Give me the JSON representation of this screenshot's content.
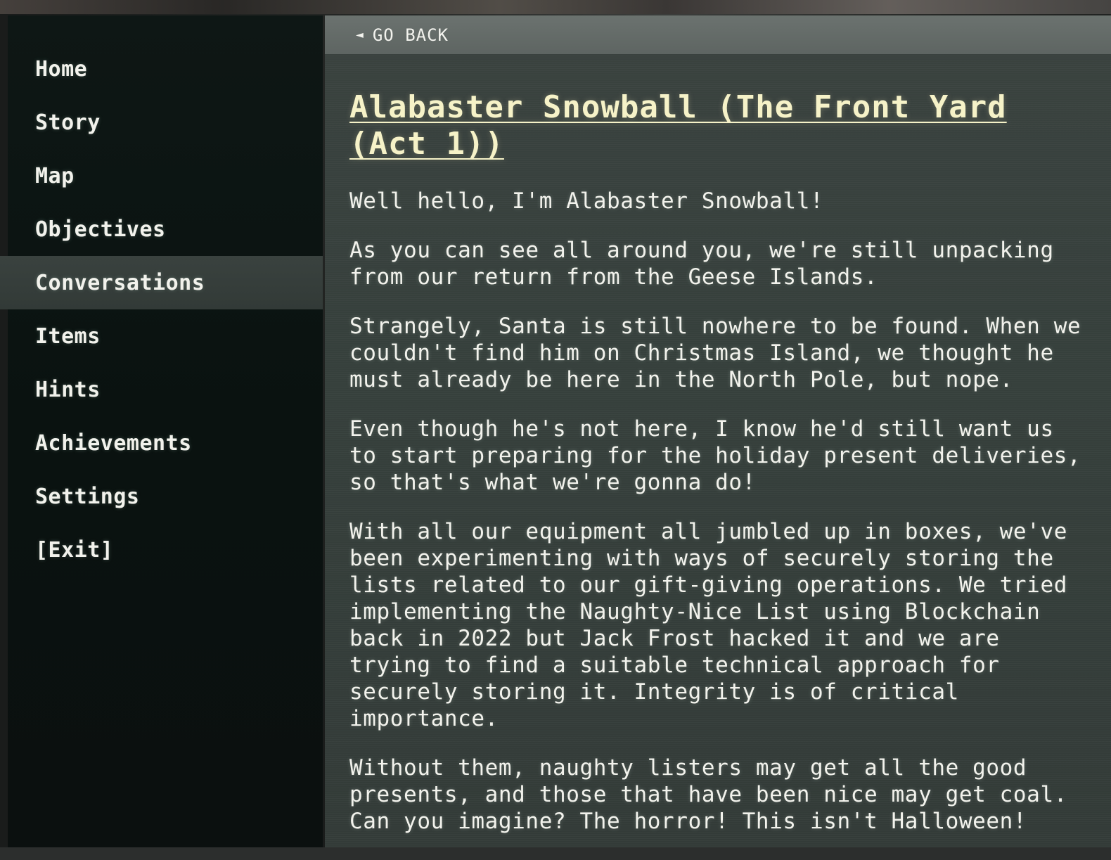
{
  "sidebar": {
    "items": [
      {
        "label": "Home",
        "active": false
      },
      {
        "label": "Story",
        "active": false
      },
      {
        "label": "Map",
        "active": false
      },
      {
        "label": "Objectives",
        "active": false
      },
      {
        "label": "Conversations",
        "active": true
      },
      {
        "label": "Items",
        "active": false
      },
      {
        "label": "Hints",
        "active": false
      },
      {
        "label": "Achievements",
        "active": false
      },
      {
        "label": "Settings",
        "active": false
      },
      {
        "label": "[Exit]",
        "active": false
      }
    ]
  },
  "back": {
    "icon": "left-triangle-icon",
    "label": "GO BACK"
  },
  "conversation": {
    "title": "Alabaster Snowball (The Front Yard (Act 1))",
    "paragraphs": [
      "Well hello, I'm Alabaster Snowball!",
      "As you can see all around you, we're still unpacking from our return from the Geese Islands.",
      "Strangely, Santa is still nowhere to be found. When we couldn't find him on Christmas Island, we thought he must already be here in the North Pole, but nope.",
      "Even though he's not here, I know he'd still want us to start preparing for the holiday present deliveries, so that's what we're gonna do!",
      "With all our equipment all jumbled up in boxes, we've been experimenting with ways of securely storing the lists related to our gift-giving operations. We tried implementing the Naughty-Nice List using Blockchain back in 2022 but Jack Frost hacked it and we are trying to find a suitable technical approach for securely storing it. Integrity is of critical importance.",
      "Without them, naughty listers may get all the good presents, and those that have been nice may get coal. Can you imagine? The horror! This isn't Halloween!"
    ]
  },
  "colors": {
    "sidebar_bg": "#0b1311",
    "active_item_bg": "#3a423f",
    "main_bg": "#373f3c",
    "back_bar_bg": "#656c69",
    "title_color": "#f6f2c8",
    "text_color": "#f2f2ec"
  }
}
